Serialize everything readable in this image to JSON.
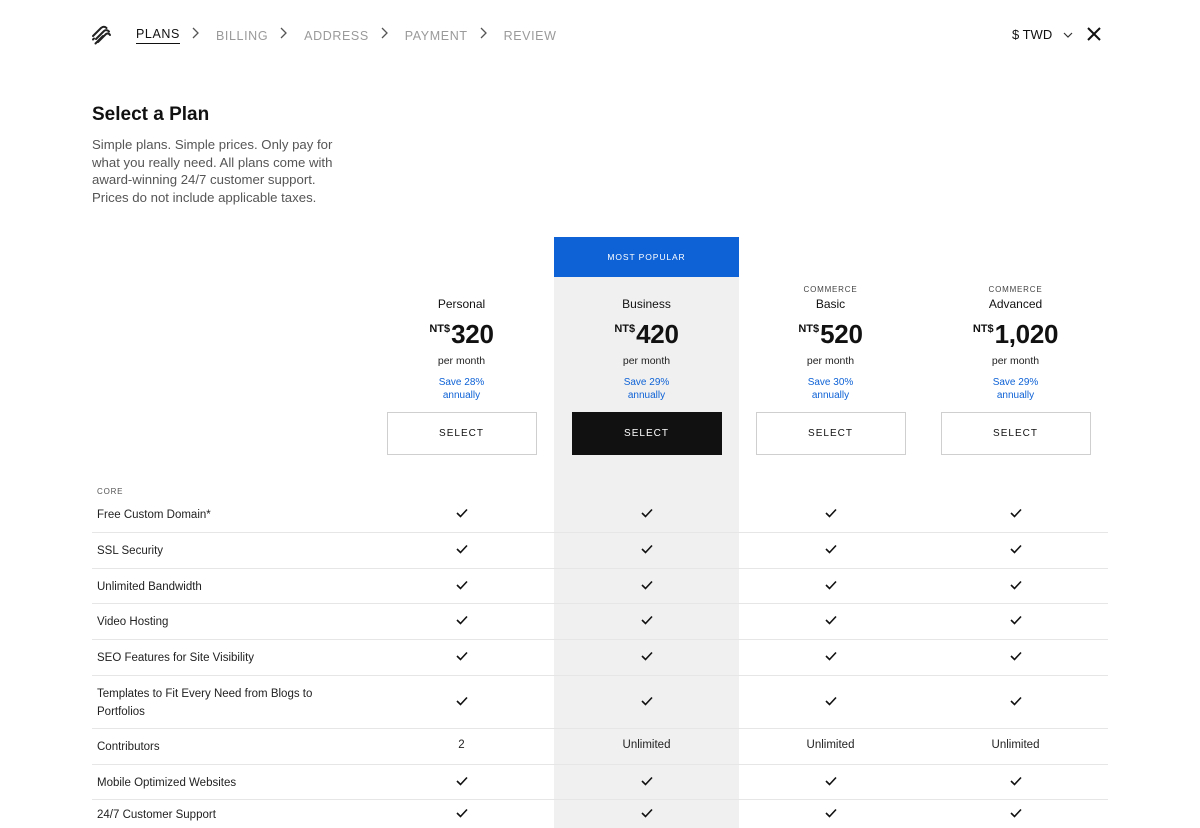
{
  "header": {
    "steps": [
      {
        "label": "PLANS",
        "active": true
      },
      {
        "label": "BILLING",
        "active": false
      },
      {
        "label": "ADDRESS",
        "active": false
      },
      {
        "label": "PAYMENT",
        "active": false
      },
      {
        "label": "REVIEW",
        "active": false
      }
    ],
    "currency": "$ TWD"
  },
  "intro": {
    "title": "Select a Plan",
    "subtitle": "Simple plans. Simple prices. Only pay for what you really need. All plans come with award-winning 24/7 customer support. Prices do not include applicable taxes."
  },
  "popular_badge": "MOST POPULAR",
  "plans": [
    {
      "eyebrow": "",
      "name": "Personal",
      "currency": "NT$",
      "price": "320",
      "per": "per month",
      "save_line1": "Save 28%",
      "save_line2": "annually",
      "button": "SELECT"
    },
    {
      "eyebrow": "",
      "name": "Business",
      "currency": "NT$",
      "price": "420",
      "per": "per month",
      "save_line1": "Save 29%",
      "save_line2": "annually",
      "button": "SELECT"
    },
    {
      "eyebrow": "COMMERCE",
      "name": "Basic",
      "currency": "NT$",
      "price": "520",
      "per": "per month",
      "save_line1": "Save 30%",
      "save_line2": "annually",
      "button": "SELECT"
    },
    {
      "eyebrow": "COMMERCE",
      "name": "Advanced",
      "currency": "NT$",
      "price": "1,020",
      "per": "per month",
      "save_line1": "Save 29%",
      "save_line2": "annually",
      "button": "SELECT"
    }
  ],
  "features": {
    "section": "CORE",
    "rows": [
      {
        "label": "Free Custom Domain*",
        "values": [
          "check",
          "check",
          "check",
          "check"
        ]
      },
      {
        "label": "SSL Security",
        "values": [
          "check",
          "check",
          "check",
          "check"
        ]
      },
      {
        "label": "Unlimited Bandwidth",
        "values": [
          "check",
          "check",
          "check",
          "check"
        ]
      },
      {
        "label": "Video Hosting",
        "values": [
          "check",
          "check",
          "check",
          "check"
        ]
      },
      {
        "label": "SEO Features for Site Visibility",
        "values": [
          "check",
          "check",
          "check",
          "check"
        ]
      },
      {
        "label": "Templates to Fit Every Need from Blogs to Portfolios",
        "values": [
          "check",
          "check",
          "check",
          "check"
        ]
      },
      {
        "label": "Contributors",
        "values": [
          "2",
          "Unlimited",
          "Unlimited",
          "Unlimited"
        ]
      },
      {
        "label": "Mobile Optimized Websites",
        "values": [
          "check",
          "check",
          "check",
          "check"
        ]
      },
      {
        "label": "24/7 Customer Support",
        "values": [
          "check",
          "check",
          "check",
          "check"
        ]
      }
    ]
  },
  "colors": {
    "accent": "#0e62d6",
    "highlight_bg": "#f0f0f0",
    "dark_button": "#111111"
  }
}
